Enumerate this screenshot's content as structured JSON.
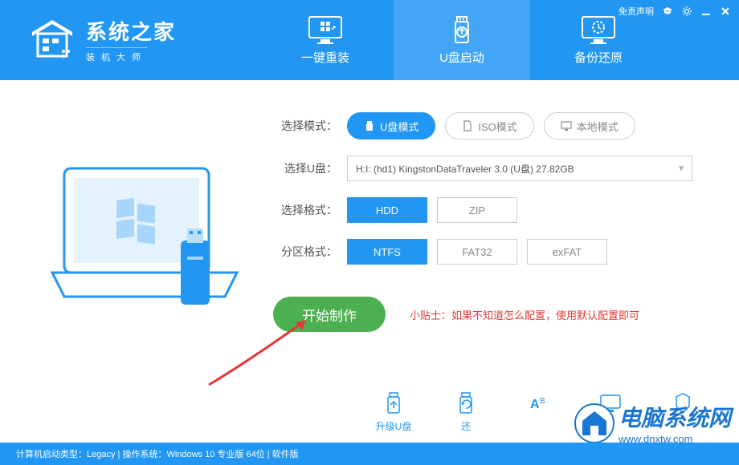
{
  "titlebar": {
    "disclaimer": "免责声明"
  },
  "logo": {
    "title": "系统之家",
    "subtitle": "装机大师"
  },
  "nav": {
    "reinstall": "一键重装",
    "usb_boot": "U盘启动",
    "backup": "备份还原"
  },
  "config": {
    "mode_label": "选择模式：",
    "mode_usb": "U盘模式",
    "mode_iso": "ISO模式",
    "mode_local": "本地模式",
    "usb_label": "选择U盘：",
    "usb_value": "H:I: (hd1) KingstonDataTraveler 3.0 (U盘) 27.82GB",
    "format_label": "选择格式：",
    "format_hdd": "HDD",
    "format_zip": "ZIP",
    "partition_label": "分区格式：",
    "partition_ntfs": "NTFS",
    "partition_fat32": "FAT32",
    "partition_exfat": "exFAT",
    "start_button": "开始制作",
    "tip": "小贴士：如果不知道怎么配置，使用默认配置即可"
  },
  "tools": {
    "upgrade": "升级U盘",
    "restore": "还"
  },
  "statusbar": {
    "text": "计算机启动类型：Legacy | 操作系统：Windows 10 专业版 64位 | 软件版"
  },
  "watermark": {
    "text": "电脑系统网",
    "url": "www.dnxtw.com"
  }
}
